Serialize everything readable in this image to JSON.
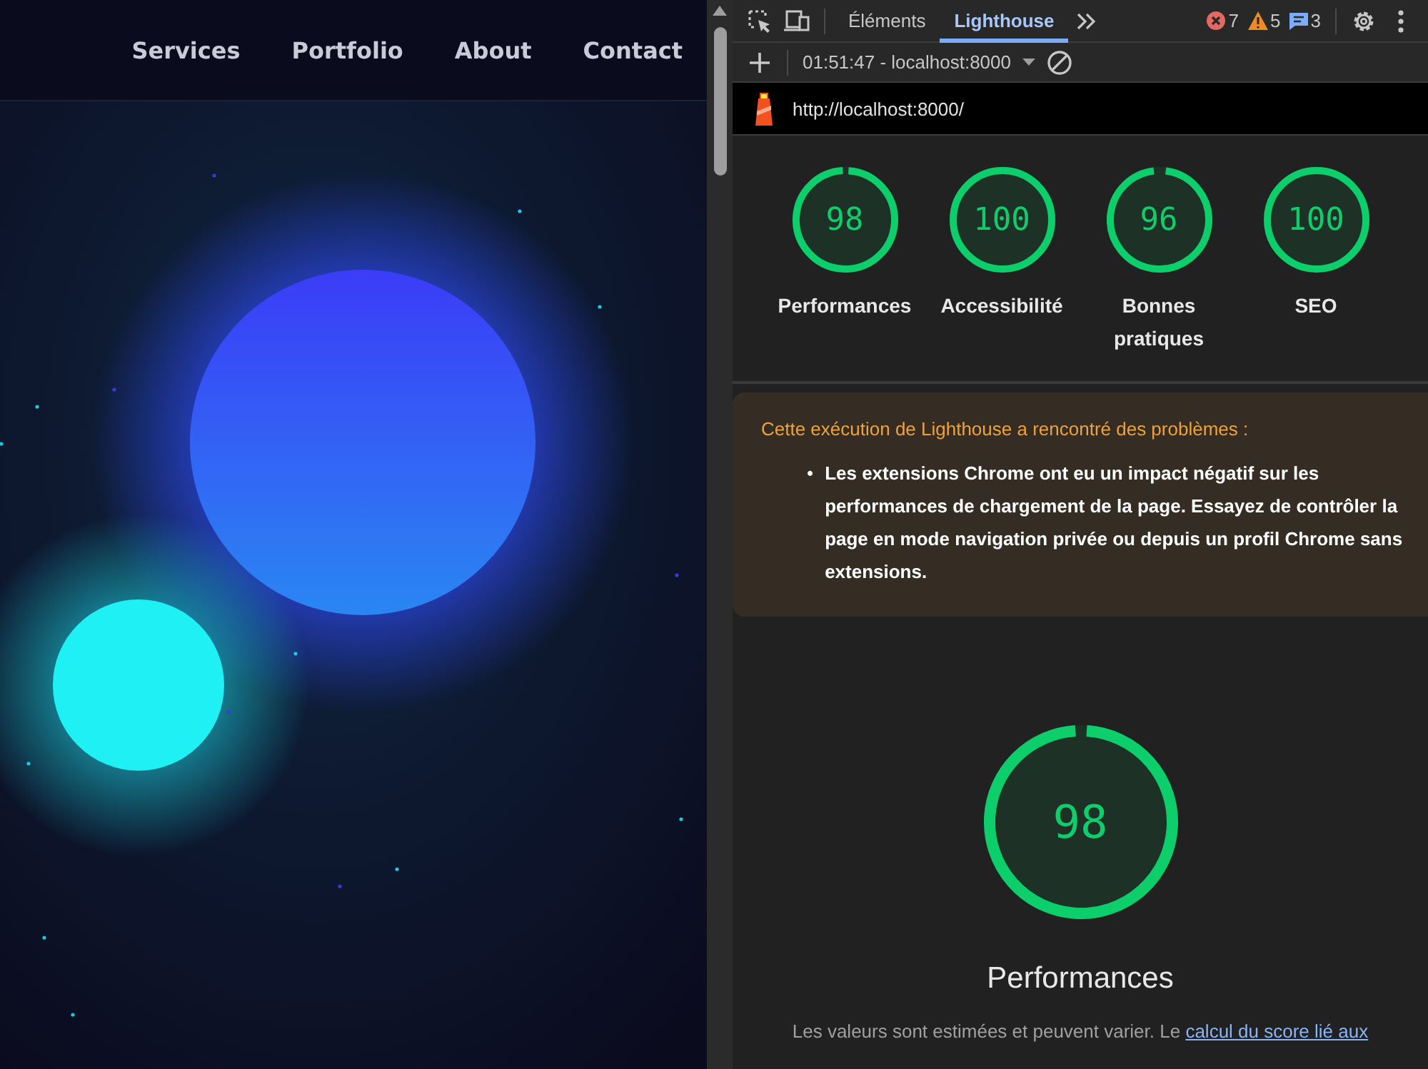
{
  "website": {
    "nav": [
      {
        "label": "Services"
      },
      {
        "label": "Portfolio"
      },
      {
        "label": "About"
      },
      {
        "label": "Contact"
      }
    ]
  },
  "devtools": {
    "tabs": [
      {
        "label": "Éléments",
        "selected": false
      },
      {
        "label": "Lighthouse",
        "selected": true
      }
    ],
    "counts": {
      "errors": "7",
      "warnings": "5",
      "messages": "3"
    },
    "report_select": "01:51:47 - localhost:8000",
    "url": "http://localhost:8000/",
    "scores": [
      {
        "label": "Performances",
        "score": "98",
        "level": 0.98
      },
      {
        "label": "Accessibilité",
        "score": "100",
        "level": 1
      },
      {
        "label": "Bonnes pratiques",
        "score": "96",
        "level": 0.96
      },
      {
        "label": "SEO",
        "score": "100",
        "level": 1
      }
    ],
    "warning": {
      "title": "Cette exécution de Lighthouse a rencontré des problèmes :",
      "items": [
        {
          "bullet": "•",
          "text": "Les extensions Chrome ont eu un impact négatif sur les performances de chargement de la page. Essayez de contrôler la page en mode navigation privée ou depuis un profil Chrome sans extensions."
        }
      ]
    },
    "main_score": {
      "score": "98",
      "level": 0.98,
      "title": "Performances"
    },
    "note": {
      "text": "Les valeurs sont estimées et peuvent varier. Le",
      "link": "calcul du score lié aux"
    }
  }
}
